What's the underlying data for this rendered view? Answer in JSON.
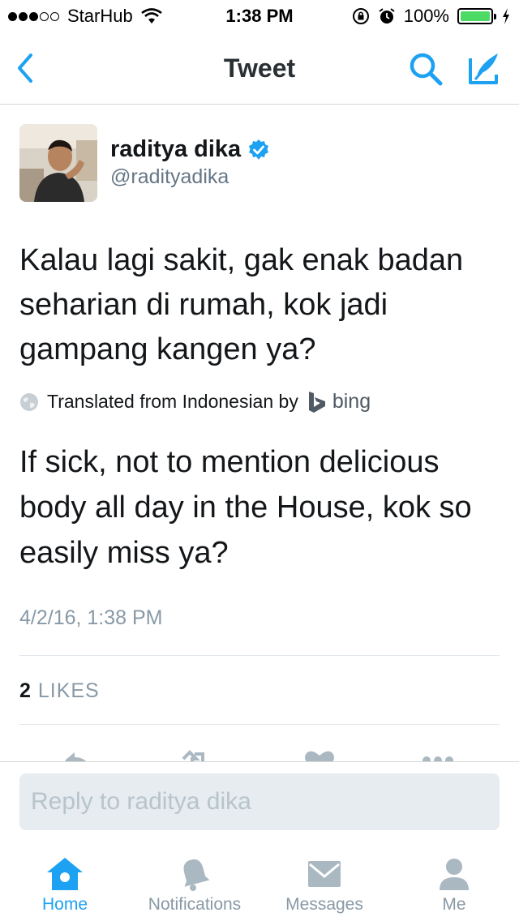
{
  "status_bar": {
    "carrier": "StarHub",
    "time": "1:38 PM",
    "battery_percent": "100%",
    "signal_bars": 3,
    "signal_total": 5,
    "battery_level": 1.0
  },
  "nav": {
    "title": "Tweet",
    "accent_color": "#1da1f2"
  },
  "tweet": {
    "name": "raditya dika",
    "handle": "@radityadika",
    "text": "Kalau lagi sakit, gak enak badan seharian di rumah, kok jadi gampang kangen ya?",
    "translated_label": "Translated from Indonesian by",
    "translator": "bing",
    "translation": "If sick, not to mention delicious body all day in the House, kok so easily miss ya?",
    "timestamp": "4/2/16, 1:38 PM",
    "likes_count": "2",
    "likes_label": "LIKES",
    "actions": [
      "reply-icon",
      "retweet-icon",
      "like-icon",
      "more-icon"
    ]
  },
  "reply": {
    "placeholder": "Reply to raditya dika"
  },
  "tabbar": {
    "tabs": [
      {
        "label": "Home",
        "icon": "home-icon",
        "active": true
      },
      {
        "label": "Notifications",
        "icon": "bell-icon",
        "active": false
      },
      {
        "label": "Messages",
        "icon": "envelope-icon",
        "active": false
      },
      {
        "label": "Me",
        "icon": "person-icon",
        "active": false
      }
    ]
  }
}
